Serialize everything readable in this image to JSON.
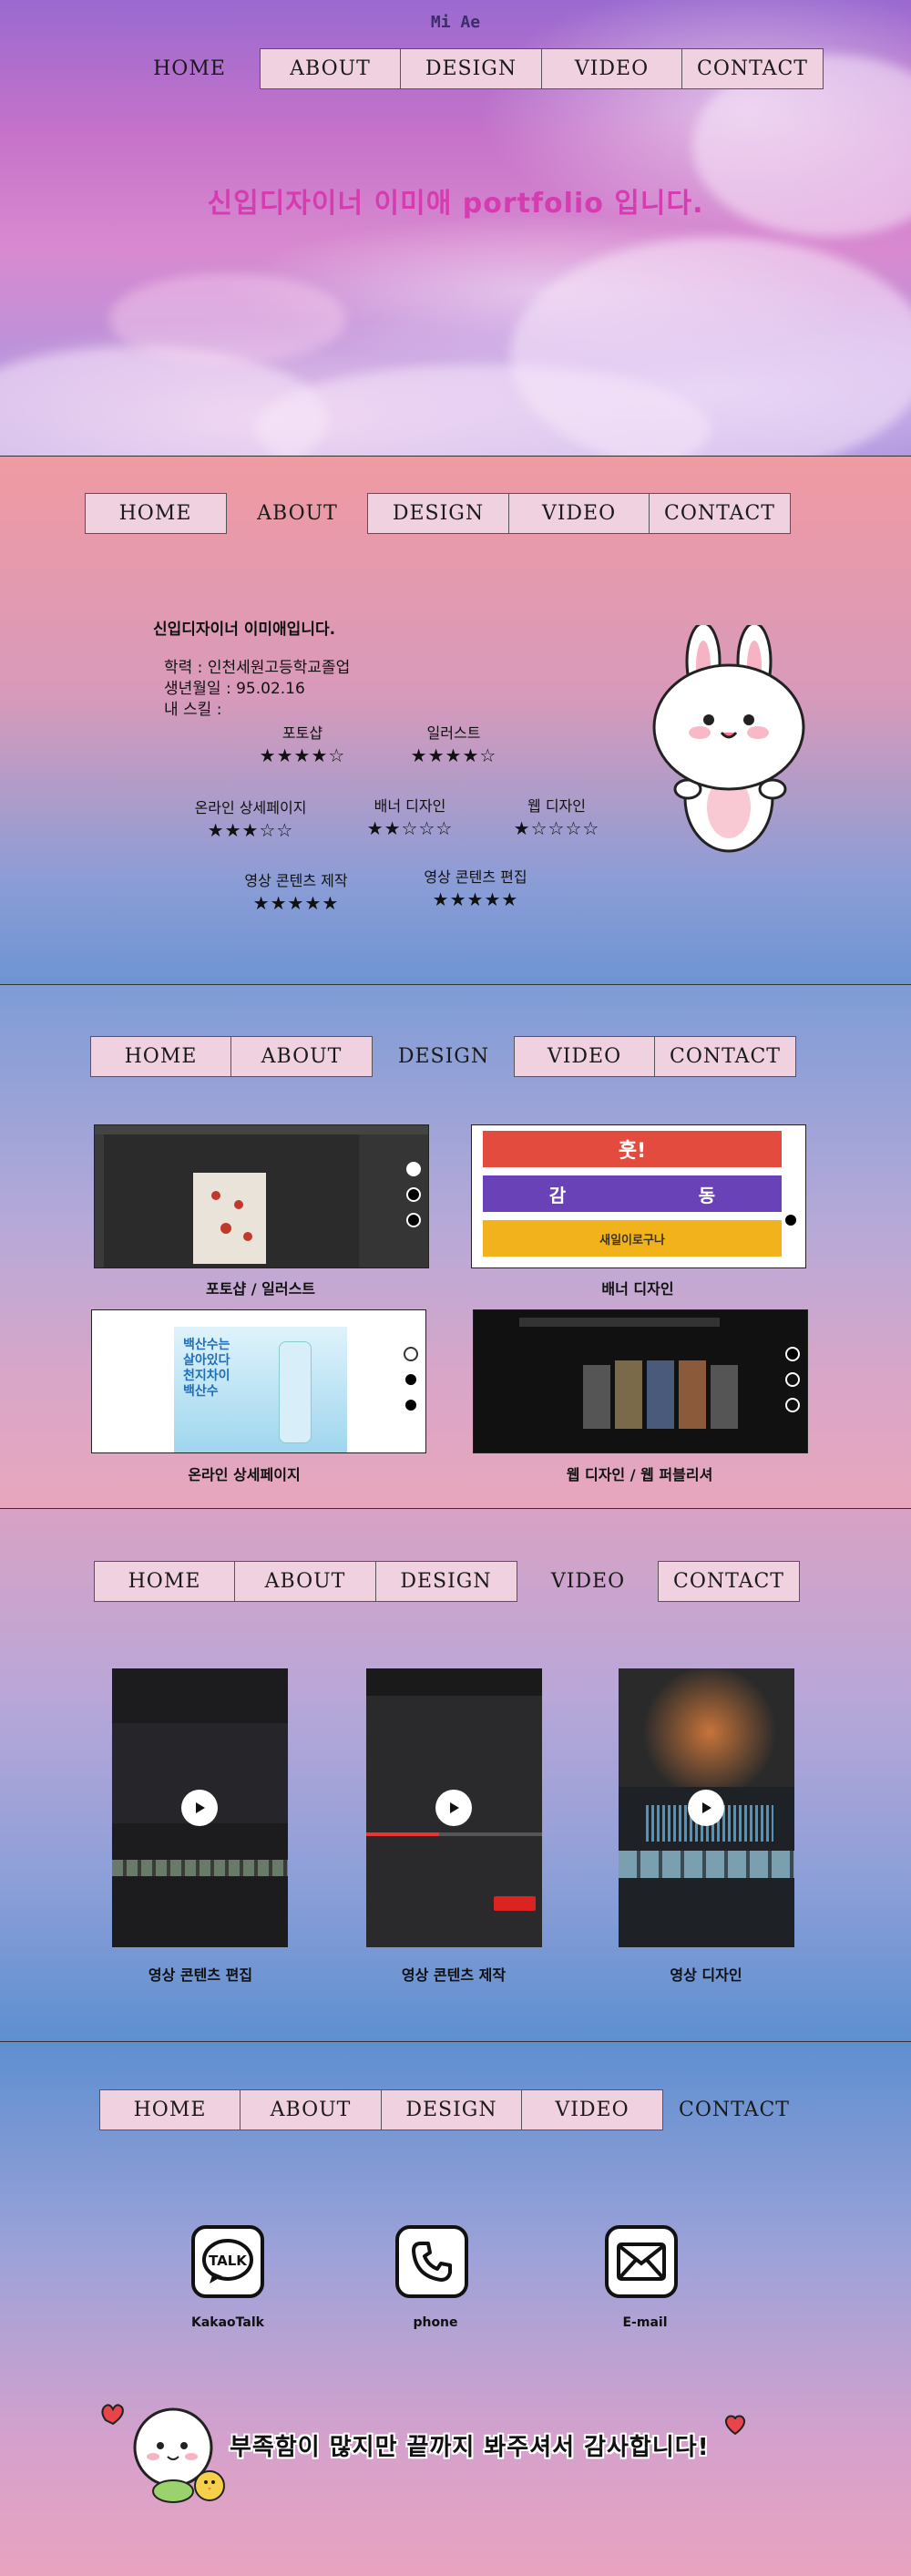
{
  "logo": "Mi Ae",
  "nav_labels": {
    "home": "HOME",
    "about": "ABOUT",
    "design": "DESIGN",
    "video": "VIDEO",
    "contact": "CONTACT"
  },
  "hero": {
    "title": "신입디자이너 이미애 portfolio 입니다."
  },
  "about": {
    "intro": "신입디자이너 이미애입니다.",
    "education": "학력 : 인천세원고등학교졸업",
    "birth": "생년월일 : 95.02.16",
    "skills_label": "내 스킬 :",
    "skills": [
      {
        "name": "포토샵",
        "stars": "★★★★☆",
        "rating": 4
      },
      {
        "name": "일러스트",
        "stars": "★★★★☆",
        "rating": 4
      },
      {
        "name": "온라인 상세페이지",
        "stars": "★★★☆☆",
        "rating": 3
      },
      {
        "name": "배너 디자인",
        "stars": "★★☆☆☆",
        "rating": 2
      },
      {
        "name": "웹 디자인",
        "stars": "★☆☆☆☆",
        "rating": 1
      },
      {
        "name": "영상 콘텐츠 제작",
        "stars": "★★★★★",
        "rating": 5
      },
      {
        "name": "영상 콘텐츠 편집",
        "stars": "★★★★★",
        "rating": 5
      }
    ]
  },
  "design": {
    "captions": [
      "포토샵 / 일러스트",
      "배너 디자인",
      "온라인 상세페이지",
      "웹 디자인 / 웹 퍼블리셔"
    ],
    "banners": [
      "훗!",
      "감",
      "동",
      "새일이로구나"
    ],
    "detail_text": [
      "백산수는",
      "살아있다",
      "천지차이",
      "백산수"
    ]
  },
  "video": {
    "captions": [
      "영상 콘텐츠 편집",
      "영상 콘텐츠 제작",
      "영상 디자인"
    ]
  },
  "contact": {
    "items": [
      {
        "label": "KakaoTalk",
        "icon": "talk-icon",
        "icon_text": "TALK"
      },
      {
        "label": "phone",
        "icon": "phone-icon"
      },
      {
        "label": "E-mail",
        "icon": "mail-icon"
      }
    ],
    "thanks": "부족함이 많지만 끝까지 봐주셔서 감사합니다!"
  },
  "colors": {
    "nav_box": "#f0d1df",
    "hero_title": "#d63bb0"
  }
}
